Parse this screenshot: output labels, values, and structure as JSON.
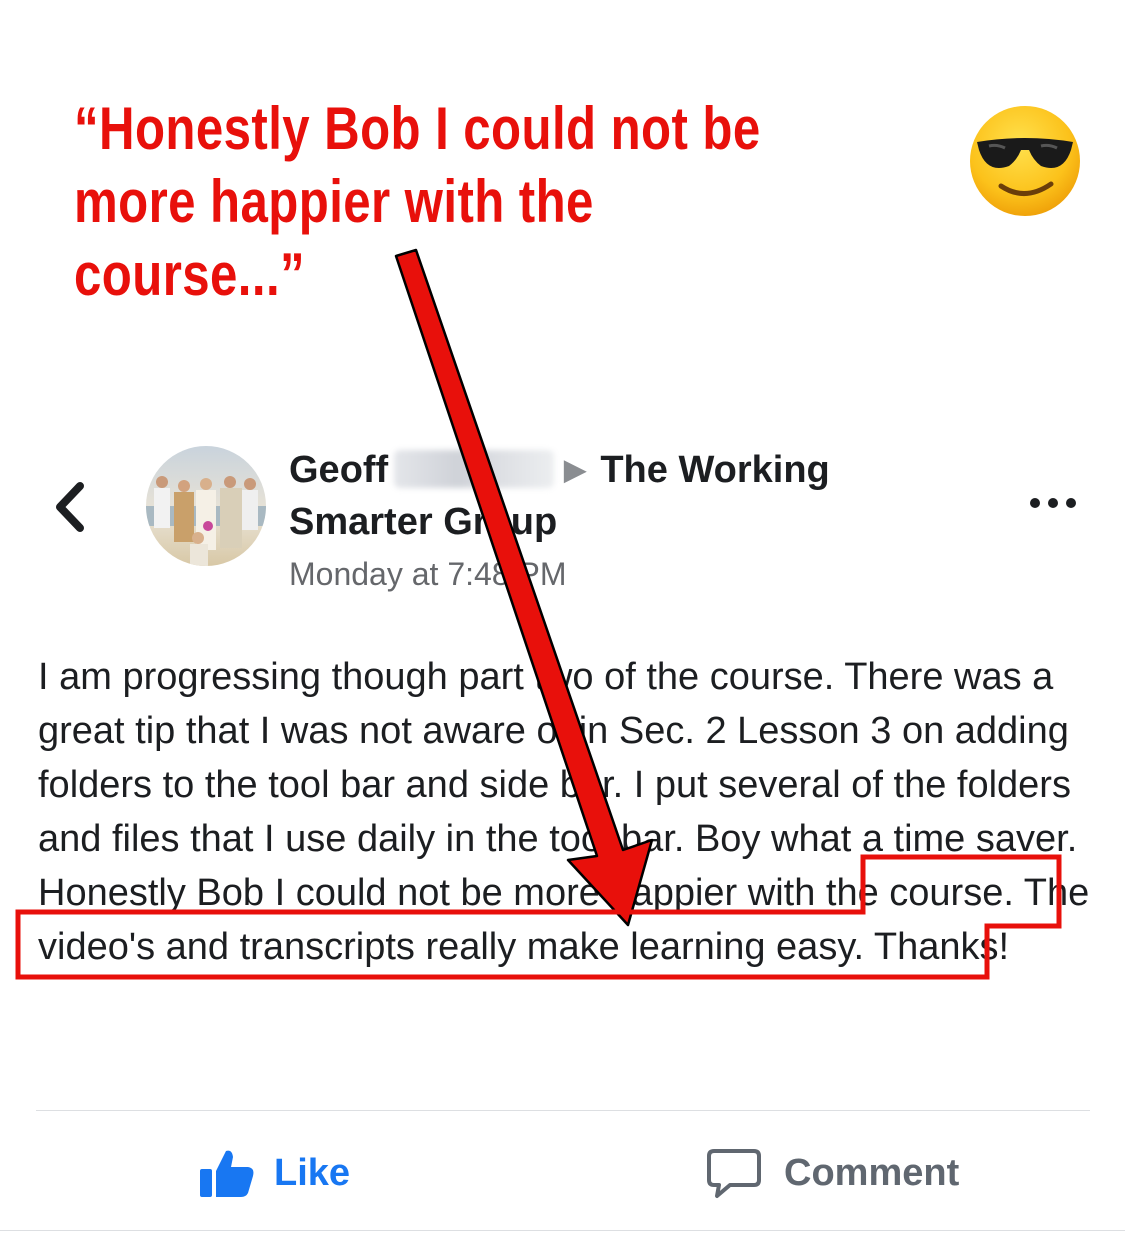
{
  "annotation": {
    "quote_line1": "“Honestly Bob I could not be",
    "quote_line2": "more happier with the course...”",
    "color": "#e8100b",
    "emoji": "smiling-face-with-sunglasses"
  },
  "post": {
    "author": "Geoff",
    "group": "The Working",
    "group_line2": "Smarter Group",
    "timestamp": "Monday at 7:48 PM",
    "body_before_highlight": "I am progressing though part two of the course. There was a great tip that I was not aware of in Sec. 2 Lesson 3 on adding folders to the tool bar and side bar. I put several of the folders and files that I use daily in the tool bar. Boy what a time saver. ",
    "body_highlight": "Honestly Bob I could not be more happier with the course.",
    "body_after_highlight": " The video's and transcripts really make learning easy. Thanks!"
  },
  "actions": {
    "like_label": "Like",
    "comment_label": "Comment",
    "like_color": "#1877f2"
  },
  "icons": {
    "back": "chevron-left-icon",
    "more": "more-options-icon",
    "like": "thumbs-up-icon",
    "comment": "comment-bubble-icon"
  }
}
